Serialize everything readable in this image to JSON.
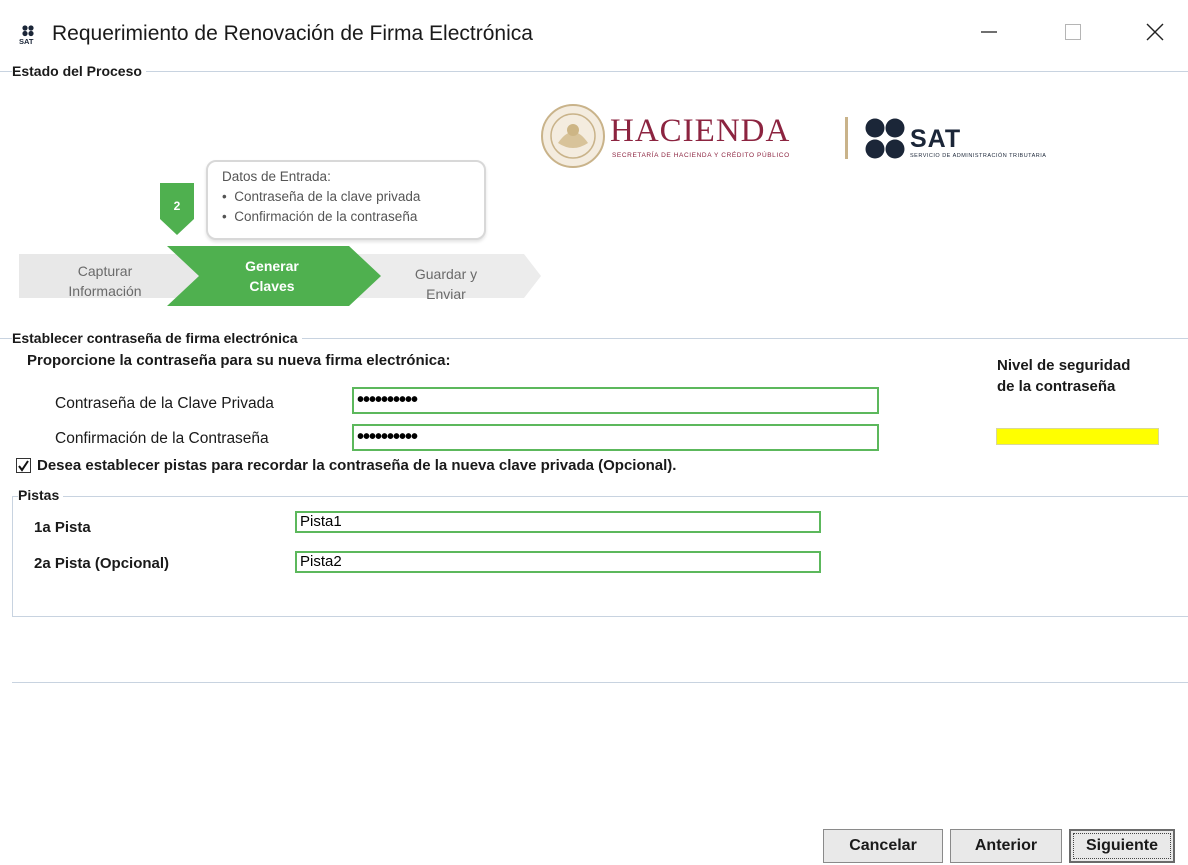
{
  "window": {
    "title": "Requerimiento de Renovación de Firma Electrónica",
    "minimize": "—",
    "maximize": "☐",
    "close": "✕"
  },
  "process": {
    "section_title": "Estado del Proceso",
    "callout_title": "Datos de Entrada:",
    "callout_items": [
      "Contraseña de la clave privada",
      "Confirmación de la contraseña"
    ],
    "current_step_number": "2",
    "steps": [
      {
        "line1": "Capturar",
        "line2": "Información"
      },
      {
        "line1": "Generar",
        "line2": "Claves"
      },
      {
        "line1": "Guardar y",
        "line2": "Enviar"
      }
    ]
  },
  "logos": {
    "hacienda": "HACIENDA",
    "hacienda_sub": "SECRETARÍA DE HACIENDA Y CRÉDITO PÚBLICO",
    "sat": "SAT",
    "sat_sub": "SERVICIO DE ADMINISTRACIÓN TRIBUTARIA"
  },
  "password_section": {
    "section_title": "Establecer contraseña de firma electrónica",
    "instruction": "Proporcione la contraseña para su nueva firma electrónica:",
    "private_key_label": "Contraseña de la Clave Privada",
    "private_key_value": "••••••••••",
    "confirm_label": "Confirmación de la Contraseña",
    "confirm_value": "••••••••••",
    "strength_label_line1": "Nivel de seguridad",
    "strength_label_line2": "de la contraseña",
    "strength_color": "#ffff00",
    "hints_checkbox_checked": true,
    "hints_checkbox_label": "Desea establecer pistas para recordar la contraseña de la nueva clave privada (Opcional)."
  },
  "hints": {
    "section_title": "Pistas",
    "hint1_label": "1a Pista",
    "hint1_value": "Pista1",
    "hint2_label": "2a Pista (Opcional)",
    "hint2_value": "Pista2"
  },
  "buttons": {
    "cancel": "Cancelar",
    "previous": "Anterior",
    "next": "Siguiente"
  },
  "colors": {
    "accent_green": "#5cb85c",
    "step_active": "#4fb04f",
    "step_inactive": "#e8e8e8",
    "hacienda_brand": "#8c2440",
    "sat_brand": "#1b2638"
  }
}
